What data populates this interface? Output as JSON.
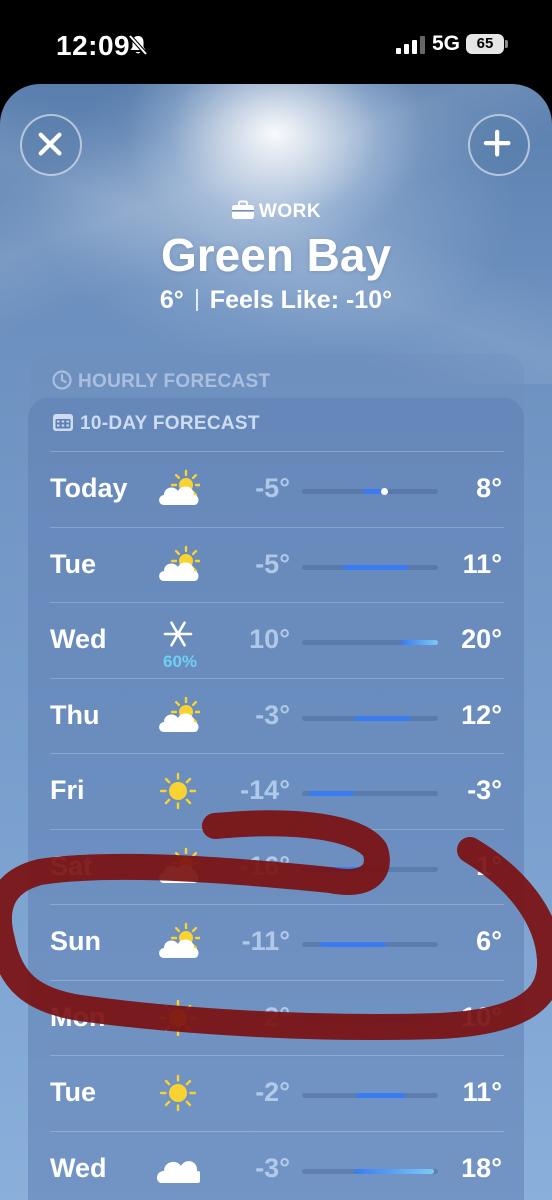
{
  "status_bar": {
    "time": "12:09",
    "network": "5G",
    "battery": "65"
  },
  "header": {
    "tag": "WORK",
    "city": "Green Bay",
    "current_temp": "6°",
    "feels_like": "Feels Like: -10°"
  },
  "hourly": {
    "title": "HOURLY FORECAST"
  },
  "forecast": {
    "title": "10-DAY FORECAST",
    "days": [
      {
        "day": "Today",
        "icon": "partly-sunny-icon",
        "precip": "",
        "low": "-5°",
        "high": "8°",
        "range": [
          0.45,
          0.62
        ],
        "current": 0.6
      },
      {
        "day": "Tue",
        "icon": "partly-sunny-icon",
        "precip": "",
        "low": "-5°",
        "high": "11°",
        "range": [
          0.3,
          0.78
        ]
      },
      {
        "day": "Wed",
        "icon": "snowflake-icon",
        "precip": "60%",
        "low": "10°",
        "high": "20°",
        "range": [
          0.73,
          1.0
        ]
      },
      {
        "day": "Thu",
        "icon": "partly-sunny-icon",
        "precip": "",
        "low": "-3°",
        "high": "12°",
        "range": [
          0.38,
          0.8
        ]
      },
      {
        "day": "Fri",
        "icon": "sun-icon",
        "precip": "",
        "low": "-14°",
        "high": "-3°",
        "range": [
          0.05,
          0.38
        ]
      },
      {
        "day": "Sat",
        "icon": "partly-sunny-icon",
        "precip": "",
        "low": "-16°",
        "high": "1°",
        "range": [
          0.0,
          0.46
        ]
      },
      {
        "day": "Sun",
        "icon": "partly-sunny-icon",
        "precip": "",
        "low": "-11°",
        "high": "6°",
        "range": [
          0.13,
          0.62
        ]
      },
      {
        "day": "Mon",
        "icon": "sun-icon",
        "precip": "",
        "low": "2°",
        "high": "10°",
        "range": [
          0.55,
          0.78
        ]
      },
      {
        "day": "Tue",
        "icon": "sun-icon",
        "precip": "",
        "low": "-2°",
        "high": "11°",
        "range": [
          0.4,
          0.76
        ]
      },
      {
        "day": "Wed",
        "icon": "cloud-icon",
        "precip": "",
        "low": "-3°",
        "high": "18°",
        "range": [
          0.38,
          0.97
        ]
      }
    ]
  },
  "colors": {
    "annotation": "#7a1010",
    "bar_cold": "#3a7bf0",
    "bar_warm": "#7ec8f5"
  }
}
